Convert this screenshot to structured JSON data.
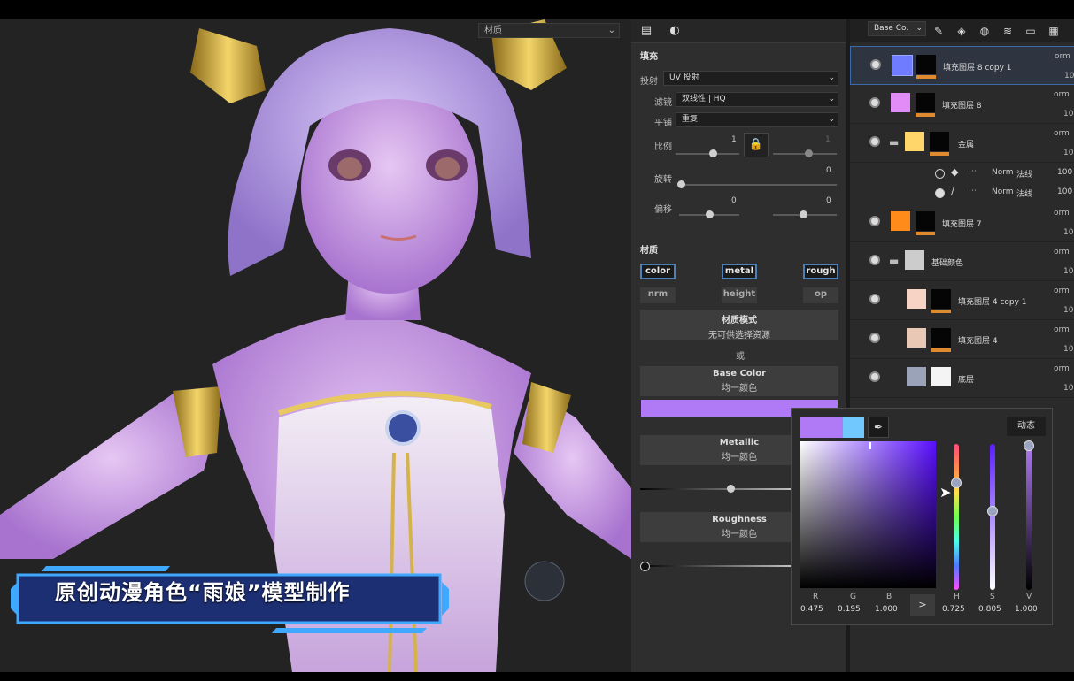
{
  "viewport": {
    "material_select": "材质",
    "title_banner": "原创动漫角色“雨娘”模型制作"
  },
  "properties": {
    "tab_icons": [
      "layer-properties-icon",
      "texture-set-icon"
    ],
    "fill_section": "填充",
    "projection_label": "投射",
    "projection_value": "UV 投射",
    "filter_label": "滤镜",
    "filter_value": "双线性 | HQ",
    "tiling_label": "平铺",
    "tiling_value": "重复",
    "scale_label": "比例",
    "scale_value": "1",
    "scale_value_locked": "1",
    "rotation_label": "旋转",
    "rotation_value": "0",
    "offset_label": "偏移",
    "offset_x": "0",
    "offset_y": "0",
    "material_section": "材质",
    "channels": [
      {
        "label": "color",
        "on": true
      },
      {
        "label": "metal",
        "on": true
      },
      {
        "label": "rough",
        "on": true
      },
      {
        "label": "nrm",
        "on": false
      },
      {
        "label": "height",
        "on": false
      },
      {
        "label": "op",
        "on": false
      }
    ],
    "material_mode_title": "材质模式",
    "material_mode_sub": "无可供选择资源",
    "or_label": "或",
    "base_color_title": "Base Color",
    "base_color_sub": "均一颜色",
    "base_color_swatch": "#b07af7",
    "metallic_title": "Metallic",
    "metallic_sub": "均一颜色",
    "metallic_level": 0.5,
    "roughness_title": "Roughness",
    "roughness_sub": "均一颜色",
    "roughness_level": 0.0
  },
  "layers": {
    "channel_select": "Base Co.",
    "toolbar_icons": [
      "paint-brush-icon",
      "add-fill-icon",
      "add-mask-icon",
      "add-layer-icon",
      "add-folder-icon",
      "delete-icon",
      "more-icon"
    ],
    "items": [
      {
        "name": "填充图层 8 copy 1",
        "swatch": "#6f7cff",
        "bar": "#e08a30",
        "orm": "orm",
        "opacity": "10",
        "selected": true,
        "type": "fill"
      },
      {
        "name": "填充图层 8",
        "swatch": "#e18cf7",
        "bar": "#e08a30",
        "orm": "orm",
        "opacity": "10",
        "selected": false,
        "type": "fill"
      },
      {
        "name": "金属",
        "swatch": "#ffd66a",
        "bar": "#e08a30",
        "orm": "orm",
        "opacity": "10",
        "selected": false,
        "type": "folder"
      },
      {
        "name": "填充图层 7",
        "swatch": "#ff8c1a",
        "bar": "#e08a30",
        "orm": "orm",
        "opacity": "10",
        "selected": false,
        "type": "fill"
      },
      {
        "name": "基础颜色",
        "swatch": "#cccccc",
        "bar": "",
        "orm": "orm",
        "opacity": "10",
        "selected": false,
        "type": "folder"
      },
      {
        "name": "填充图层 4 copy 1",
        "swatch": "#f6d3c4",
        "bar": "#e08a30",
        "orm": "orm",
        "opacity": "10",
        "selected": false,
        "type": "fill"
      },
      {
        "name": "填充图层 4",
        "swatch": "#e9c8b6",
        "bar": "#e08a30",
        "orm": "orm",
        "opacity": "10",
        "selected": false,
        "type": "fill"
      },
      {
        "name": "底层",
        "swatch": "#d8d8d8",
        "bar": "",
        "orm": "orm",
        "opacity": "10",
        "selected": false,
        "type": "fill"
      }
    ],
    "sublayers": [
      {
        "blend": "Norm",
        "mode": "法线",
        "opacity": "100"
      },
      {
        "blend": "Norm",
        "mode": "法线",
        "opacity": "100"
      }
    ]
  },
  "color_picker": {
    "current_color": "#b07af7",
    "previous_color": "#70c8ff",
    "dynamic_button": "动态",
    "labels": [
      "R",
      "G",
      "B",
      "H",
      "S",
      "V"
    ],
    "r": "0.475",
    "g": "0.195",
    "b": "1.000",
    "h": "0.725",
    "s": "0.805",
    "v": "1.000",
    "arrow": ">"
  }
}
